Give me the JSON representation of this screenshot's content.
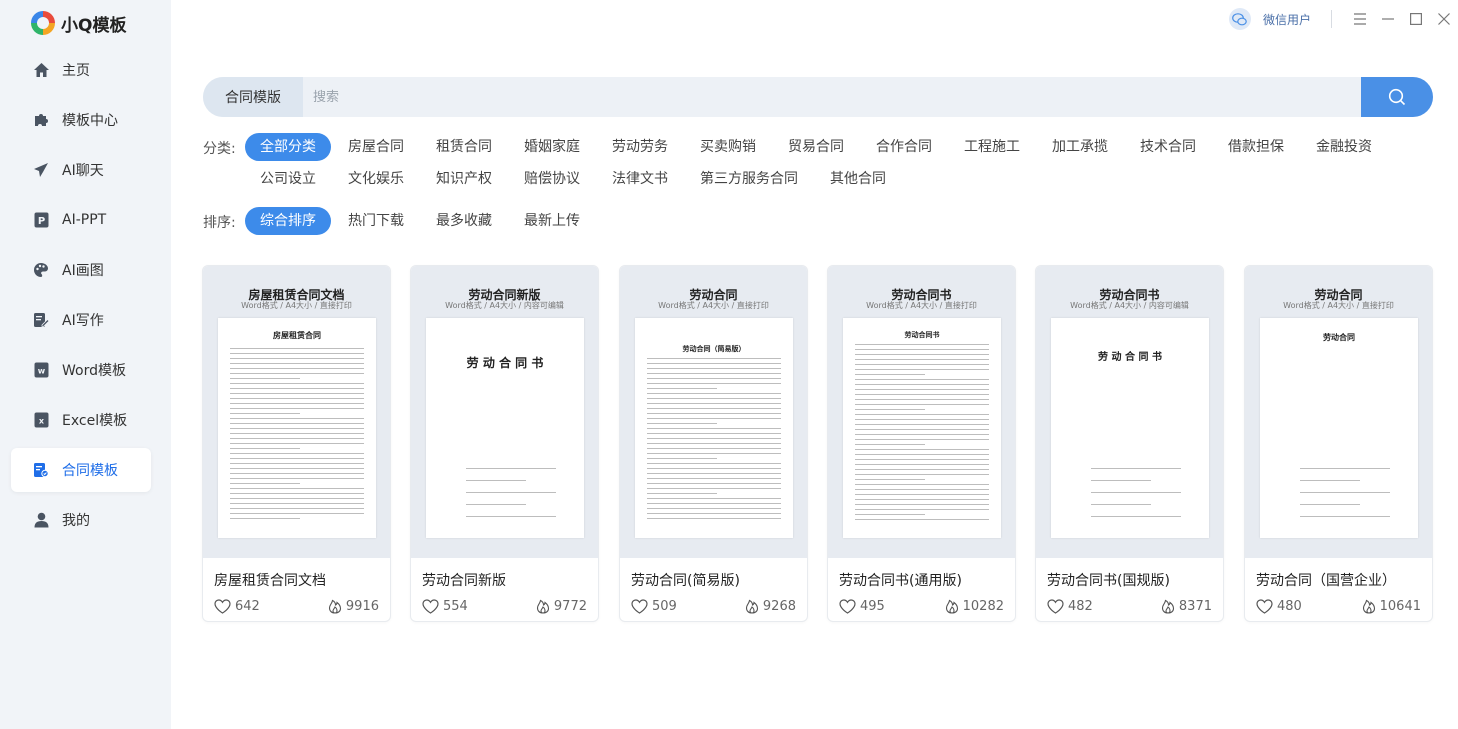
{
  "app": {
    "name": "小Q模板"
  },
  "user": {
    "name": "微信用户"
  },
  "nav": [
    {
      "label": "主页",
      "icon": "home-icon"
    },
    {
      "label": "模板中心",
      "icon": "puzzle-icon"
    },
    {
      "label": "AI聊天",
      "icon": "send-icon"
    },
    {
      "label": "AI-PPT",
      "icon": "ppt-icon"
    },
    {
      "label": "AI画图",
      "icon": "palette-icon"
    },
    {
      "label": "AI写作",
      "icon": "edit-icon"
    },
    {
      "label": "Word模板",
      "icon": "word-icon"
    },
    {
      "label": "Excel模板",
      "icon": "excel-icon"
    },
    {
      "label": "合同模板",
      "icon": "contract-icon",
      "active": true
    },
    {
      "label": "我的",
      "icon": "user-icon"
    }
  ],
  "search": {
    "category": "合同模版",
    "placeholder": "搜索"
  },
  "filters": {
    "category_label": "分类:",
    "categories": [
      "全部分类",
      "房屋合同",
      "租赁合同",
      "婚姻家庭",
      "劳动劳务",
      "买卖购销",
      "贸易合同",
      "合作合同",
      "工程施工",
      "加工承揽",
      "技术合同",
      "借款担保",
      "金融投资",
      "公司设立",
      "文化娱乐",
      "知识产权",
      "赔偿协议",
      "法律文书",
      "第三方服务合同",
      "其他合同"
    ],
    "sort_label": "排序:",
    "sorts": [
      "综合排序",
      "热门下载",
      "最多收藏",
      "最新上传"
    ]
  },
  "cards": [
    {
      "thumb_title": "房屋租赁合同文档",
      "thumb_sub": "Word格式 / A4大小 / 直接打印",
      "doc_title": "房屋租赁合同",
      "name": "房屋租赁合同文档",
      "likes": "642",
      "hot": "9916"
    },
    {
      "thumb_title": "劳动合同新版",
      "thumb_sub": "Word格式 / A4大小 / 内容可编辑",
      "doc_title": "劳 动 合 同 书",
      "name": "劳动合同新版",
      "likes": "554",
      "hot": "9772"
    },
    {
      "thumb_title": "劳动合同",
      "thumb_sub": "Word格式 / A4大小 / 直接打印",
      "doc_title": "劳动合同（简易版）",
      "name": "劳动合同(简易版)",
      "likes": "509",
      "hot": "9268"
    },
    {
      "thumb_title": "劳动合同书",
      "thumb_sub": "Word格式 / A4大小 / 直接打印",
      "doc_title": "劳动合同书",
      "name": "劳动合同书(通用版)",
      "likes": "495",
      "hot": "10282"
    },
    {
      "thumb_title": "劳动合同书",
      "thumb_sub": "Word格式 / A4大小 / 内容可编辑",
      "doc_title": "劳 动 合 同 书",
      "name": "劳动合同书(国规版)",
      "likes": "482",
      "hot": "8371"
    },
    {
      "thumb_title": "劳动合同",
      "thumb_sub": "Word格式 / A4大小 / 直接打印",
      "doc_title": "劳动合同",
      "name": "劳动合同（国营企业）",
      "likes": "480",
      "hot": "10641"
    }
  ]
}
